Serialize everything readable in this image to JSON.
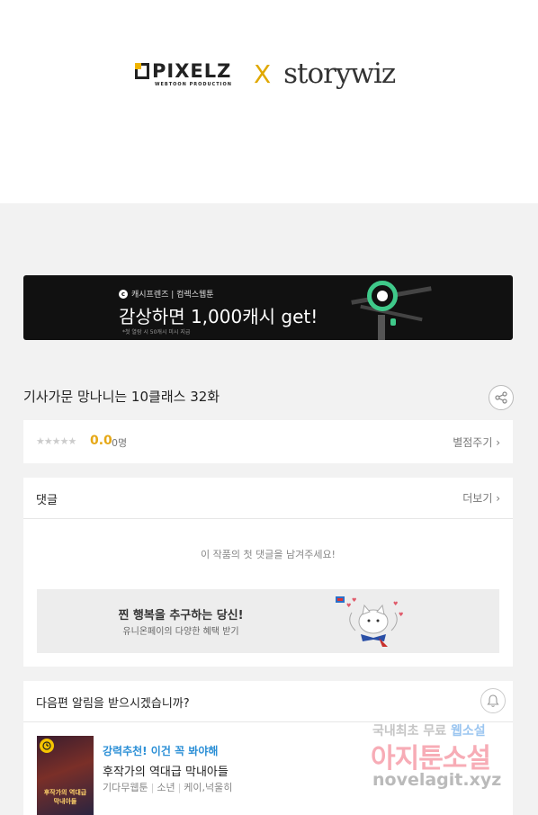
{
  "banner": {
    "brand_left": "PIXELZ",
    "brand_left_sub": "WEBTOON PRODUCTION",
    "separator": "X",
    "brand_right": "storywiz"
  },
  "ad": {
    "brand": "캐시프렌즈 | 컴렉스웹툰",
    "brand_icon": "c",
    "headline": "감상하면 1,000캐시 get!",
    "note": "*첫 열람 시 50캐시 미시 지급"
  },
  "episode": {
    "title": "기사가문 망나니는 10클래스 32화",
    "share_icon": "share-icon"
  },
  "rating": {
    "stars": "★★★★★",
    "score": "0.0",
    "count": "0명",
    "rate_label": "별점주기 ›"
  },
  "comments": {
    "label": "댓글",
    "more_label": "더보기 ›",
    "empty_message": "이 작품의 첫 댓글을 남겨주세요!",
    "promo_title": "찐 행복을 추구하는 당신!",
    "promo_subtitle": "유니온페이의 다양한 혜택 받기"
  },
  "alarm": {
    "question": "다음편 알림을 받으시겠습니까?",
    "bell_icon": "bell-icon"
  },
  "recommendation": {
    "tag": "강력추천! 이건 꼭 봐야해",
    "title": "후작가의 역대급 막내아들",
    "genre": "기다무웹툰",
    "audience": "소년",
    "authors": "케이,넉울히",
    "cover_text": "후작가의 역대급 막내아들"
  },
  "watermark": {
    "line1_a": "국내최초 무료 ",
    "line1_b": "웹소설",
    "line2": "아지툰소설",
    "line3": "novelagit.xyz"
  },
  "colors": {
    "accent_gold": "#e6a817",
    "link_blue": "#2b8fd6",
    "ad_green": "#3fc98a"
  }
}
